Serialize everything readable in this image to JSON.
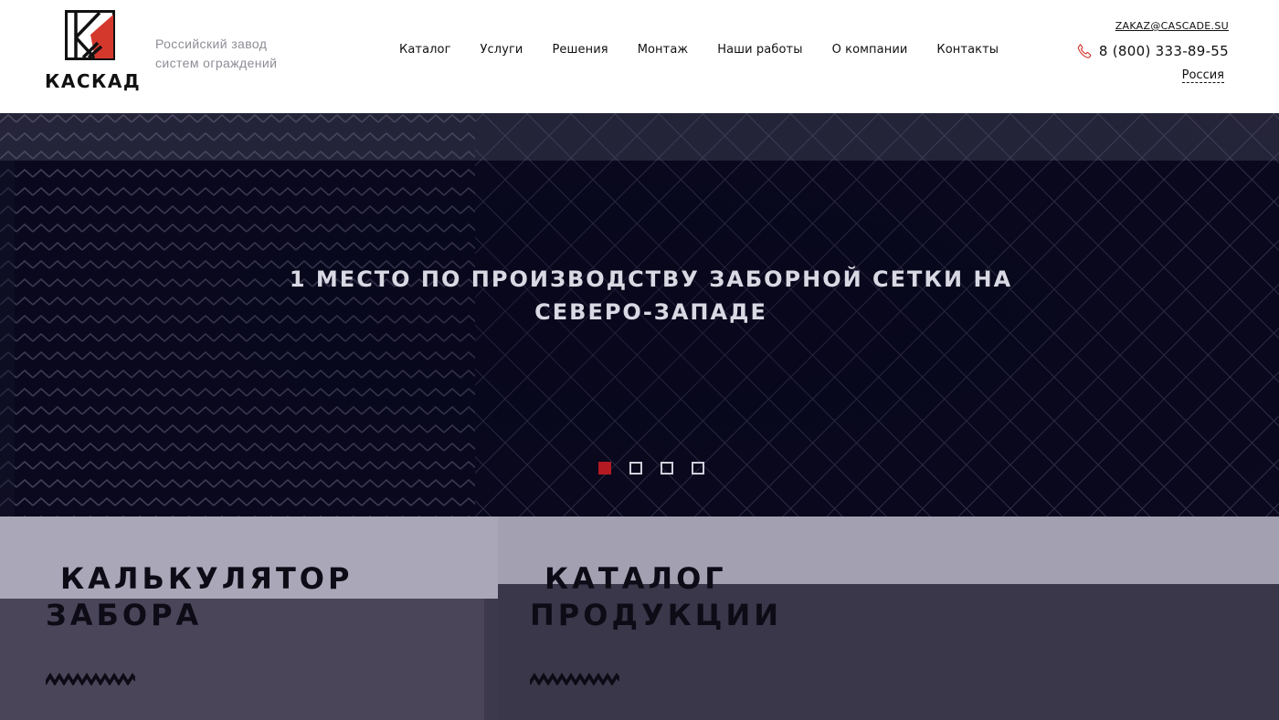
{
  "brand": {
    "name": "КАСКАД",
    "tagline_line1": "Российский завод",
    "tagline_line2": "систем ограждений",
    "colors": {
      "accent": "#d4382d",
      "dark": "#111111"
    }
  },
  "nav": {
    "items": [
      {
        "label": "Каталог"
      },
      {
        "label": "Услуги"
      },
      {
        "label": "Решения"
      },
      {
        "label": "Монтаж"
      },
      {
        "label": "Наши работы"
      },
      {
        "label": "О компании"
      },
      {
        "label": "Контакты"
      }
    ]
  },
  "contacts": {
    "email": "ZAKAZ@CASCADE.SU",
    "phone": "8 (800) 333-89-55",
    "phone_icon": "phone-icon",
    "region": "Россия"
  },
  "hero": {
    "title": "1 место по производству заборной сетки на Северо-Западе",
    "slides_total": 4,
    "active_slide": 1,
    "colors": {
      "dot_active": "#b31a22",
      "dot_inactive": "#cfcfda"
    }
  },
  "cards": {
    "calculator": {
      "line1": "Калькулятор",
      "line2": "забора",
      "icon": "zigzag-icon"
    },
    "catalog": {
      "line1": "Каталог",
      "line2": "продукции",
      "icon": "zigzag-icon"
    }
  }
}
